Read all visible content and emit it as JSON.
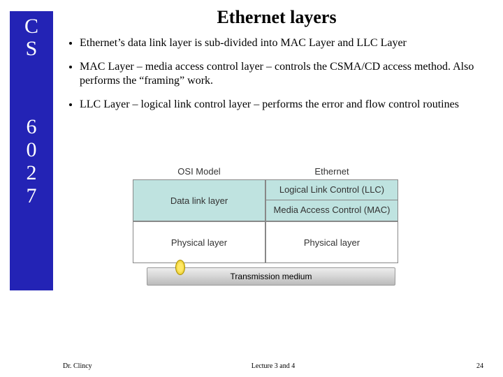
{
  "sidebar": {
    "line1": "C",
    "line2": "S",
    "n1": "6",
    "n2": "0",
    "n3": "2",
    "n4": "7"
  },
  "title": "Ethernet layers",
  "bullets": [
    "Ethernet’s data link layer is sub-divided into MAC Layer and LLC Layer",
    "MAC Layer – media access control layer – controls the CSMA/CD access method.  Also performs the “framing” work.",
    "LLC Layer – logical link control layer – performs the error and flow control routines"
  ],
  "diagram": {
    "header_left": "OSI Model",
    "header_right": "Ethernet",
    "row1_left": "Data link layer",
    "row1_right_a": "Logical Link Control (LLC)",
    "row1_right_b": "Media Access Control (MAC)",
    "row2_left": "Physical layer",
    "row2_right": "Physical layer",
    "medium": "Transmission medium"
  },
  "footer": {
    "left": "Dr. Clincy",
    "center": "Lecture 3 and 4",
    "right": "24"
  }
}
